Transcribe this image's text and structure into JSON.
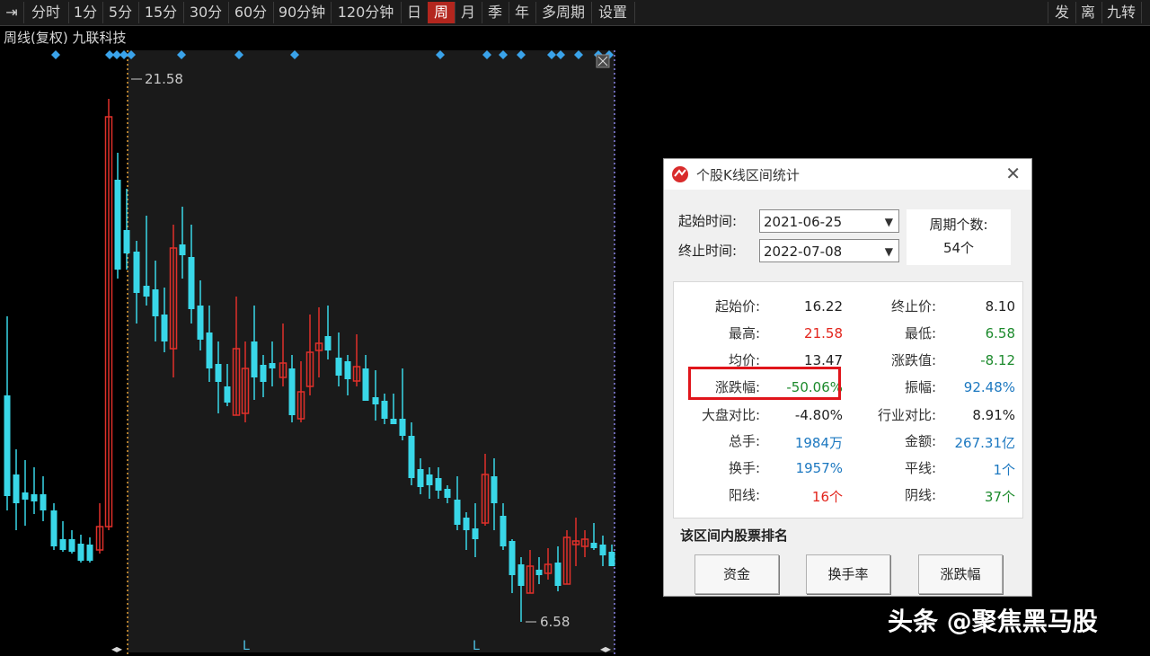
{
  "toolbar": {
    "left": [
      "分时",
      "1分",
      "5分",
      "15分",
      "30分",
      "60分",
      "90分钟",
      "120分钟",
      "日",
      "周",
      "月",
      "季",
      "年",
      "多周期",
      "设置"
    ],
    "active": "周",
    "right": [
      "发",
      "离",
      "九转"
    ]
  },
  "subtitle": {
    "period": "周线(复权)",
    "stock": "九联科技"
  },
  "chart": {
    "high_label": "21.58",
    "low_label": "6.58",
    "up_color": "#e0302a",
    "down_color": "#39d7e8",
    "bottom_marks": [
      "L",
      "L"
    ]
  },
  "dialog": {
    "title": "个股K线区间统计",
    "start_label": "起始时间:",
    "start_value": "2021-06-25",
    "end_label": "终止时间:",
    "end_value": "2022-07-08",
    "count_label": "周期个数:",
    "count_value": "54个",
    "stats": {
      "start_price_label": "起始价:",
      "start_price": "16.22",
      "end_price_label": "终止价:",
      "end_price": "8.10",
      "high_label": "最高:",
      "high": "21.58",
      "low_label": "最低:",
      "low": "6.58",
      "avg_label": "均价:",
      "avg": "13.47",
      "change_label": "涨跌值:",
      "change": "-8.12",
      "pct_label": "涨跌幅:",
      "pct": "-50.06%",
      "amp_label": "振幅:",
      "amp": "92.48%",
      "market_label": "大盘对比:",
      "market": "-4.80%",
      "industry_label": "行业对比:",
      "industry": "8.91%",
      "volume_label": "总手:",
      "volume": "1984万",
      "amount_label": "金额:",
      "amount": "267.31亿",
      "turnover_label": "换手:",
      "turnover": "1957%",
      "flat_label": "平线:",
      "flat": "1个",
      "up_label": "阳线:",
      "up": "16个",
      "down_label": "阴线:",
      "down": "37个"
    },
    "rank_title": "该区间内股票排名",
    "buttons": [
      "资金",
      "换手率",
      "涨跌幅"
    ]
  },
  "watermark": "头条 @聚焦黑马股"
}
